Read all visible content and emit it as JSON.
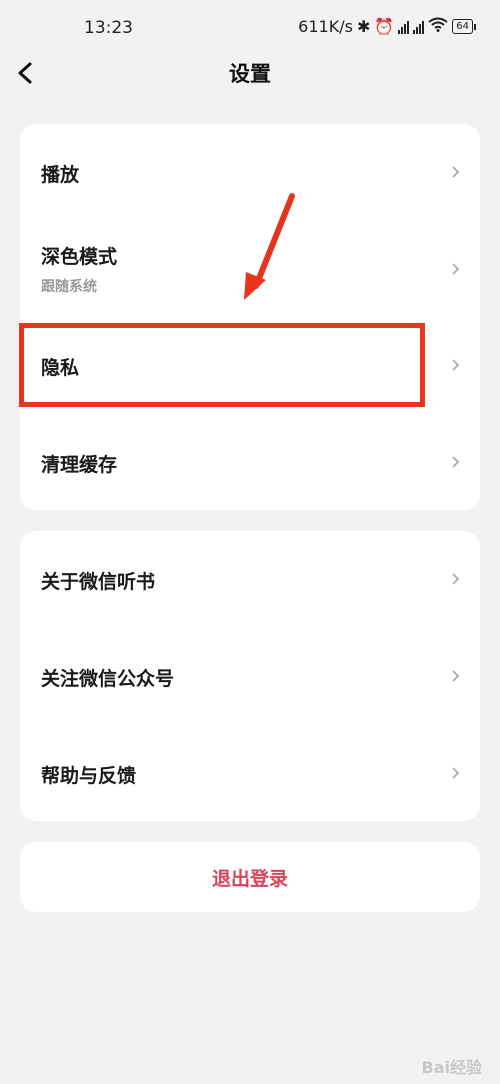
{
  "status_bar": {
    "time": "13:23",
    "network_speed": "611K/s",
    "battery": "64"
  },
  "header": {
    "title": "设置",
    "back_icon": "chevron-left-icon"
  },
  "group1": [
    {
      "label": "播放"
    },
    {
      "label": "深色模式",
      "sublabel": "跟随系统"
    },
    {
      "label": "隐私"
    },
    {
      "label": "清理缓存"
    }
  ],
  "group2": [
    {
      "label": "关于微信听书"
    },
    {
      "label": "关注微信公众号"
    },
    {
      "label": "帮助与反馈"
    }
  ],
  "logout": {
    "label": "退出登录",
    "color": "#d6455a"
  },
  "annotation": {
    "highlight_color": "#e8341c",
    "highlighted_item": "隐私"
  },
  "watermark": "Bai经验"
}
